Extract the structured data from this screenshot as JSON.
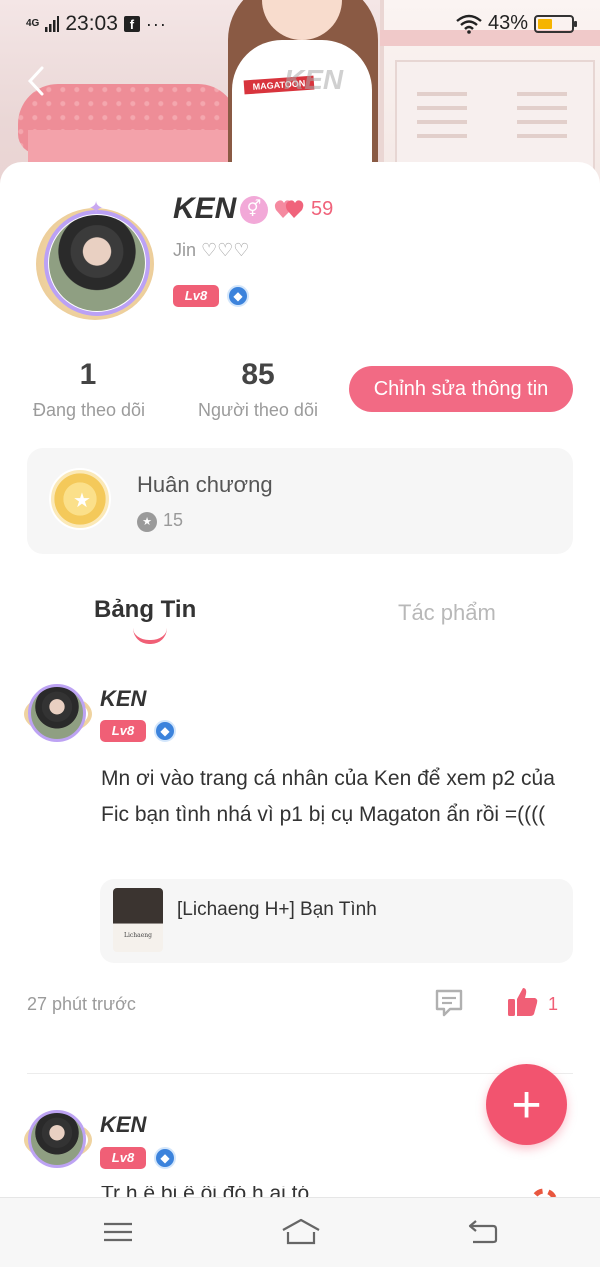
{
  "status_bar": {
    "network": "4G",
    "time": "23:03",
    "app_icon": "facebook-icon",
    "more": "···",
    "battery": "43%",
    "battery_level": 0.43
  },
  "banner": {
    "shirt_text": "MAGATOON",
    "watermark": "KEN"
  },
  "profile": {
    "name": "KEN",
    "gender_symbol": "⚥",
    "heart_count": "59",
    "bio": "Jin ♡♡♡",
    "level": "Lv8",
    "following_count": "1",
    "following_label": "Đang theo dõi",
    "followers_count": "85",
    "followers_label": "Người theo dõi",
    "edit_button": "Chỉnh sửa thông tin"
  },
  "medals": {
    "title": "Huân chương",
    "count": "15"
  },
  "tabs": [
    {
      "label": "Bảng Tin",
      "active": true
    },
    {
      "label": "Tác phẩm",
      "active": false
    }
  ],
  "posts": [
    {
      "author": "KEN",
      "level": "Lv8",
      "text": "Mn ơi vào trang cá nhân của Ken để xem p2 của Fic bạn tình nhá vì p1 bị cụ Magaton ẩn rồi =((((",
      "attachment_title": "[Lichaeng H+] Bạn Tình",
      "attachment_thumb_text": "Lichaeng",
      "time": "27 phút trước",
      "like_count": "1"
    },
    {
      "author": "KEN",
      "level": "Lv8",
      "text_preview": "Tr  h    ể  bi         ề   ồi  đó   h    ai  tó"
    }
  ],
  "fab_label": "+",
  "nav": {
    "menu": "menu-icon",
    "home": "home-icon",
    "back": "back-icon"
  },
  "colors": {
    "accent": "#f26a84",
    "fab": "#f2546f",
    "level_badge": "#f05f76",
    "verified_badge": "#3c83dc"
  }
}
